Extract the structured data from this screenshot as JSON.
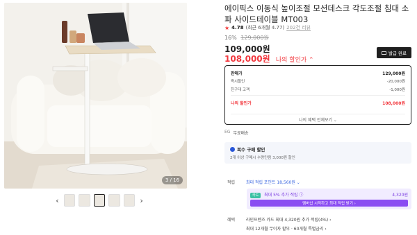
{
  "gallery": {
    "counter": "3 / 16",
    "prev_arrow": "‹",
    "next_arrow": "›",
    "thumbnails": 5,
    "active_thumbnail": 3
  },
  "product": {
    "title": "에이픽스 이동식 높이조절 모션데스크 각도조절 침대 소파 사이드테이블 MT003",
    "rating": "4.78",
    "rating_detail": "(최근 6개월 4.77)",
    "review_count": "202건 리뷰",
    "discount_pct": "16%",
    "original_price": "129,000원",
    "price": "109,000원",
    "my_price": "108,000원",
    "my_price_label": "나의 할인가 ⌃",
    "coupon_button": "발급 완료"
  },
  "price_box": {
    "rows": [
      {
        "label": "판매가",
        "value": "129,000원"
      },
      {
        "label": "즉시할인",
        "value": "-20,000원"
      },
      {
        "label": "친구대 고객",
        "value": "-1,000원"
      },
      {
        "label": "나의 할인가",
        "value": "108,000원"
      }
    ],
    "more_label": "나의 혜택 전체보기 ⌄"
  },
  "shipping": {
    "label": "EG",
    "value": "무료배송"
  },
  "bundle": {
    "title": "복수 구매 할인",
    "subtitle": "2개 이상 구매시 수량만큼 3,000원 할인"
  },
  "points": {
    "label": "적립",
    "text": "최대 적립 포인트 18,560원 ⌄",
    "card_tag": "카드",
    "card_text": "최대 5% 추가 적립 ⓘ",
    "card_value": "4,320원",
    "card_cta": "멤버십 시작하고 최대 적립 받기 ›"
  },
  "benefits": {
    "label": "혜택",
    "line1": "라인프렌즈 카드 최대 4,320원 추가 적립(4%) ›",
    "line2": "최대 12개월 무이자 할부 · 60개월 특별금리 ›"
  },
  "colors": {
    "accent_red": "#f2383e",
    "accent_blue": "#3a66e0",
    "accent_purple": "#8a4cf2"
  }
}
